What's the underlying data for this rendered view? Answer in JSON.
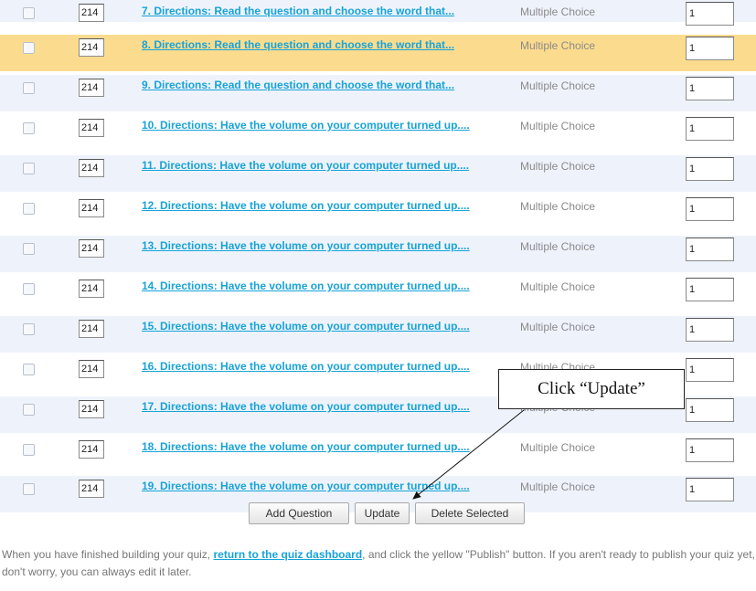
{
  "rows": [
    {
      "q_num": "214",
      "title": "7. Directions: Read the question and choose the word that...",
      "type": "Multiple Choice",
      "points": "1",
      "style": "alt"
    },
    {
      "q_num": "214",
      "title": "8. Directions: Read the question and choose the word that...",
      "type": "Multiple Choice",
      "points": "1",
      "style": "hl"
    },
    {
      "q_num": "214",
      "title": "9. Directions: Read the question and choose the word that...",
      "type": "Multiple Choice",
      "points": "1",
      "style": "alt"
    },
    {
      "q_num": "214",
      "title": "10. Directions: Have the volume on your computer turned up....",
      "type": "Multiple Choice",
      "points": "1",
      "style": ""
    },
    {
      "q_num": "214",
      "title": "11. Directions: Have the volume on your computer turned up....",
      "type": "Multiple Choice",
      "points": "1",
      "style": "alt"
    },
    {
      "q_num": "214",
      "title": "12. Directions: Have the volume on your computer turned up....",
      "type": "Multiple Choice",
      "points": "1",
      "style": ""
    },
    {
      "q_num": "214",
      "title": "13. Directions: Have the volume on your computer turned up....",
      "type": "Multiple Choice",
      "points": "1",
      "style": "alt"
    },
    {
      "q_num": "214",
      "title": "14. Directions: Have the volume on your computer turned up....",
      "type": "Multiple Choice",
      "points": "1",
      "style": ""
    },
    {
      "q_num": "214",
      "title": "15. Directions: Have the volume on your computer turned up....",
      "type": "Multiple Choice",
      "points": "1",
      "style": "alt"
    },
    {
      "q_num": "214",
      "title": "16. Directions: Have the volume on your computer turned up....",
      "type": "Multiple Choice",
      "points": "1",
      "style": ""
    },
    {
      "q_num": "214",
      "title": "17. Directions: Have the volume on your computer turned up....",
      "type": "Multiple Choice",
      "points": "1",
      "style": "alt"
    },
    {
      "q_num": "214",
      "title": "18. Directions: Have the volume on your computer turned up....",
      "type": "Multiple Choice",
      "points": "1",
      "style": ""
    },
    {
      "q_num": "214",
      "title": "19. Directions: Have the volume on your computer turned up....",
      "type": "Multiple Choice",
      "points": "1",
      "style": "alt"
    }
  ],
  "buttons": {
    "add_question": "Add Question",
    "update": "Update",
    "delete_selected": "Delete Selected"
  },
  "footer": {
    "text_before": "When you have finished building your quiz, ",
    "link": "return to the quiz dashboard",
    "text_after": ", and click the yellow \"Publish\" button. If you aren't ready to publish your quiz yet, don't worry, you can always edit it later."
  },
  "callout": {
    "text": "Click “Update”"
  },
  "colors": {
    "link": "#18a3d8",
    "highlight_row": "#fbdc8e",
    "alt_row": "#eef3fb"
  }
}
